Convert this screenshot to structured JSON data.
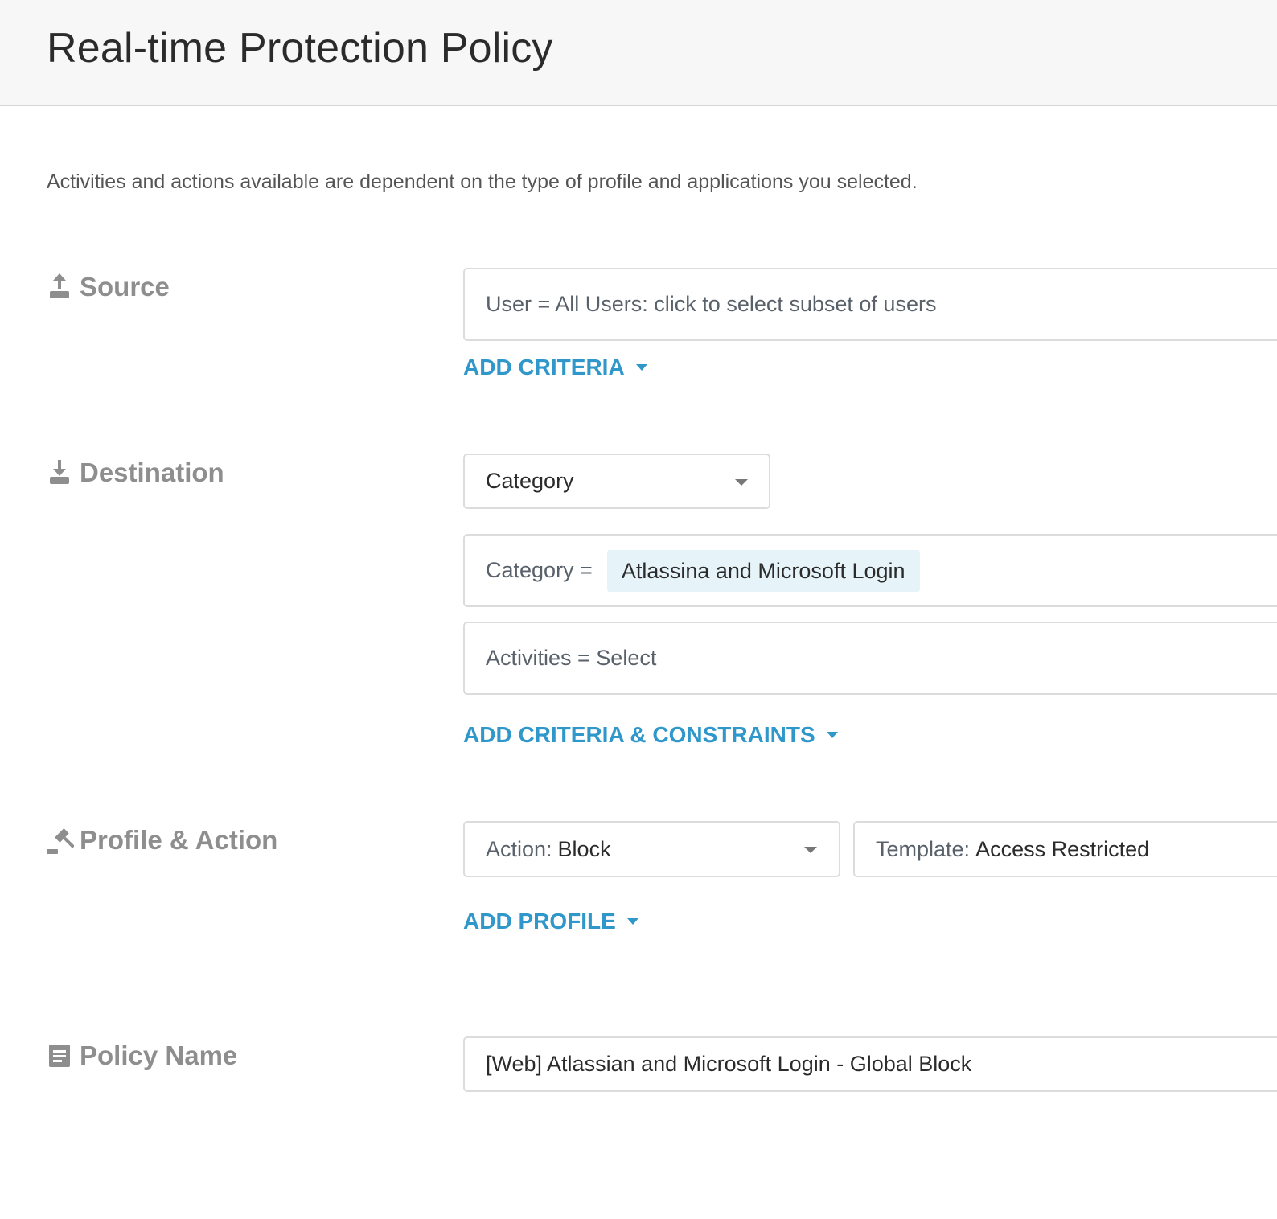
{
  "page": {
    "title": "Real-time Protection Policy",
    "description": "Activities and actions available are dependent on the type of profile and applications you selected."
  },
  "source": {
    "label": "Source",
    "icon": "upload-icon",
    "user_field": "User = All Users: click to select subset of users",
    "add_criteria": "ADD CRITERIA"
  },
  "destination": {
    "label": "Destination",
    "icon": "download-icon",
    "type_select": "Category",
    "category_prefix": "Category =",
    "category_chip": "Atlassina and Microsoft Login",
    "activities_field": "Activities = Select",
    "add_criteria_constraints": "ADD CRITERIA & CONSTRAINTS"
  },
  "profile_action": {
    "label": "Profile & Action",
    "icon": "gavel-icon",
    "action_prefix": "Action:",
    "action_value": "Block",
    "template_prefix": "Template:",
    "template_value": "Access Restricted",
    "add_profile": "ADD PROFILE"
  },
  "policy_name": {
    "label": "Policy Name",
    "icon": "document-icon",
    "value": "[Web] Atlassian and Microsoft Login - Global Block"
  },
  "colors": {
    "link": "#2f97c9",
    "chip_bg": "#e6f4fa",
    "header_bg": "#f7f7f7",
    "label_gray": "#8e8e8e"
  }
}
